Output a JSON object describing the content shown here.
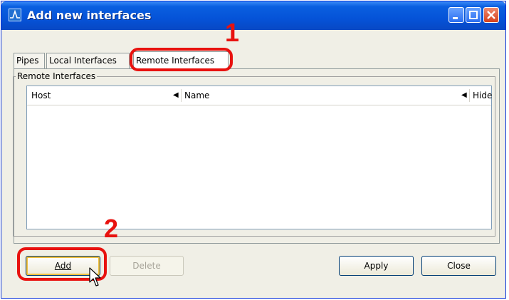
{
  "window": {
    "title": "Add new interfaces",
    "app_icon": "wireshark-icon",
    "title_buttons": [
      "minimize",
      "maximize",
      "close"
    ]
  },
  "tabs": [
    {
      "label": "Pipes",
      "active": false
    },
    {
      "label": "Local Interfaces",
      "active": false
    },
    {
      "label": "Remote Interfaces",
      "active": true
    }
  ],
  "panel": {
    "group_label": "Remote Interfaces",
    "columns": [
      {
        "label": "Host",
        "sort_icon": "triangle-left-icon"
      },
      {
        "label": "Name",
        "sort_icon": "triangle-left-icon"
      },
      {
        "label": "Hide"
      }
    ],
    "rows": []
  },
  "buttons": {
    "add": "Add",
    "delete": "Delete",
    "apply": "Apply",
    "close": "Close"
  },
  "annotations": {
    "step_1": "1",
    "step_2": "2",
    "color": "#e8120f"
  }
}
